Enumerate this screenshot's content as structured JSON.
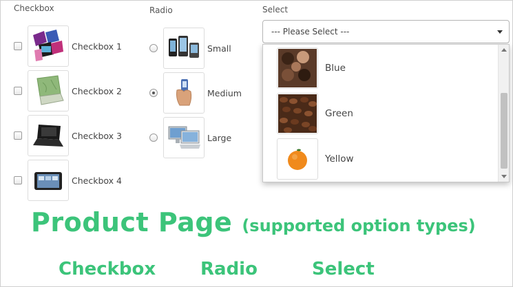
{
  "checkbox_group": {
    "label": "Checkbox",
    "options": [
      {
        "label": "Checkbox 1",
        "image": "laptops-collage-image",
        "checked": false
      },
      {
        "label": "Checkbox 2",
        "image": "green-laptop-image",
        "checked": false
      },
      {
        "label": "Checkbox 3",
        "image": "black-laptop-image",
        "checked": false
      },
      {
        "label": "Checkbox 4",
        "image": "tablet-image",
        "checked": false
      }
    ]
  },
  "radio_group": {
    "label": "Radio",
    "options": [
      {
        "label": "Small",
        "image": "phones-image",
        "checked": false
      },
      {
        "label": "Medium",
        "image": "hand-holding-phone-image",
        "checked": true
      },
      {
        "label": "Large",
        "image": "computers-image",
        "checked": false
      }
    ]
  },
  "select_group": {
    "label": "Select",
    "selected": "--- Please Select ---",
    "options": [
      {
        "label": "Blue",
        "image": "chocolates-box-image"
      },
      {
        "label": "Green",
        "image": "coffee-beans-image"
      },
      {
        "label": "Yellow",
        "image": "orange-image"
      }
    ]
  },
  "promo": {
    "title": "Product Page",
    "subtitle": "(supported option types)",
    "types": [
      "Checkbox",
      "Radio",
      "Select"
    ]
  },
  "colors": {
    "promo_green": "#3cc47a",
    "border": "#dcdcdc"
  }
}
